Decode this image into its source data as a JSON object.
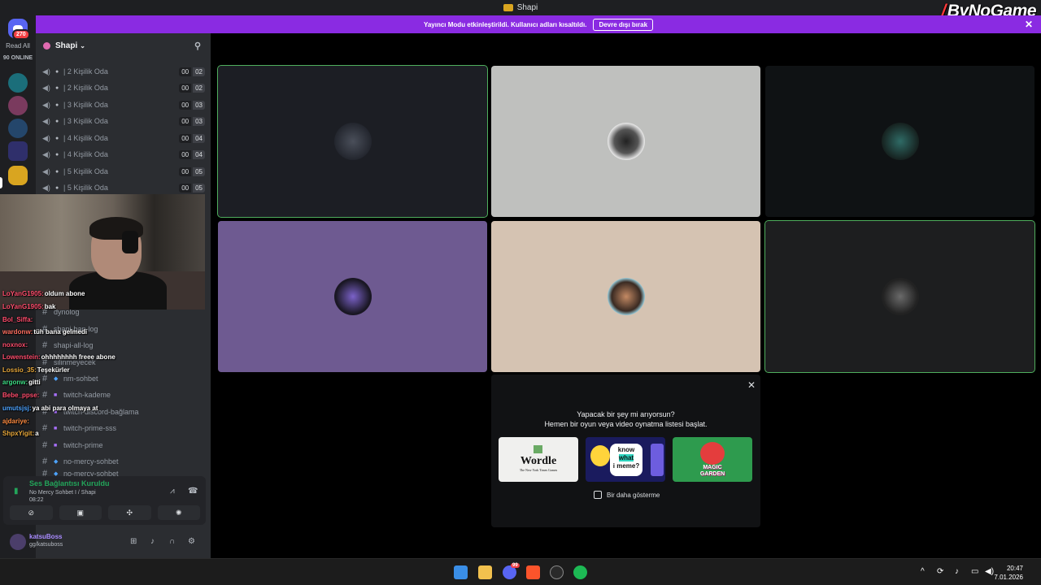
{
  "window": {
    "title": "Shapi",
    "watermark": "ByNoGame"
  },
  "streamer_mode": {
    "message": "Yayıncı Modu etkinleştirildi. Kullanıcı adları kısaltıldı.",
    "button": "Devre dışı bırak"
  },
  "rail": {
    "badge": "270",
    "read_all": "Read All",
    "online": "90 ONLINE"
  },
  "server": {
    "name": "Shapi"
  },
  "voice_channels": [
    {
      "name": "| 2 Kişilik Oda",
      "a": "00",
      "b": "02"
    },
    {
      "name": "| 2 Kişilik Oda",
      "a": "00",
      "b": "02"
    },
    {
      "name": "| 3 Kişilik Oda",
      "a": "00",
      "b": "03"
    },
    {
      "name": "| 3 Kişilik Oda",
      "a": "00",
      "b": "03"
    },
    {
      "name": "| 4 Kişilik Oda",
      "a": "00",
      "b": "04"
    },
    {
      "name": "| 4 Kişilik Oda",
      "a": "00",
      "b": "04"
    },
    {
      "name": "| 5 Kişilik Oda",
      "a": "00",
      "b": "05"
    },
    {
      "name": "| 5 Kişilik Oda",
      "a": "00",
      "b": "05"
    }
  ],
  "text_channels": [
    {
      "name": "dynolog"
    },
    {
      "name": "shapi-ban-log"
    },
    {
      "name": "shapi-all-log"
    },
    {
      "name": "silinmeyecek"
    },
    {
      "name": "nm-sohbet"
    },
    {
      "name": "twitch-kademe"
    },
    {
      "name": "twitch-discord-bağlama"
    },
    {
      "name": "twitch-prime-sss"
    },
    {
      "name": "twitch-prime"
    },
    {
      "name": "no-mercy-sohbet"
    },
    {
      "name": "no-mercy-sohbet"
    }
  ],
  "chat_overlay": [
    {
      "user": "LoYanG1905:",
      "msg": "oldum abone",
      "color": "#ff4d6d"
    },
    {
      "user": "LoYanG1905:",
      "msg": "bak",
      "color": "#ff4d6d"
    },
    {
      "user": "Bol_Siffa:",
      "msg": "",
      "color": "#ff4d6d"
    },
    {
      "user": "wardonw:",
      "msg": "tüh bana gelmedi",
      "color": "#ff6f61"
    },
    {
      "user": "noxnox:",
      "msg": "",
      "color": "#ff4d6d"
    },
    {
      "user": "Lowenstein:",
      "msg": "ohhhhhhhh freee abone",
      "color": "#ff4d6d"
    },
    {
      "user": "Lossio_35:",
      "msg": "Teşekürler",
      "color": "#e8a83b"
    },
    {
      "user": "argonw:",
      "msg": "gitti",
      "color": "#3ddc84"
    },
    {
      "user": "Bebe_ppse:",
      "msg": "",
      "color": "#ff4d6d"
    },
    {
      "user": "umutsjsj:",
      "msg": "ya abi para olmaya at",
      "color": "#4da3ff"
    },
    {
      "user": "ajdariye:",
      "msg": "",
      "color": "#ff8c42"
    },
    {
      "user": "ShpxYigit:",
      "msg": "a",
      "color": "#e8a83b"
    }
  ],
  "voice_status": {
    "title": "Ses Bağlantısı Kuruldu",
    "channel": "No Mercy Sohbet I / Shapi",
    "timer": "08:22"
  },
  "user": {
    "name": "katsuBoss",
    "status": "gg/katsuboss"
  },
  "activities": {
    "prompt1": "Yapacak bir şey mi arıyorsun?",
    "prompt2": "Hemen bir oyun veya video oynatma listesi başlat.",
    "wordle_title": "Wordle",
    "wordle_sub": "The New York Times Games",
    "meme_line1": "know",
    "meme_line2": "what",
    "meme_line3": "i meme?",
    "garden_line1": "MAGIC",
    "garden_line2": "GARDEN",
    "dont_show": "Bir daha gösterme"
  },
  "taskbar": {
    "time": "20:47",
    "date": "7.01.2026",
    "discord_badge": "99"
  },
  "colors": {
    "accent": "#8a2be2",
    "speaking": "#4fae5d",
    "connected": "#23a55a"
  }
}
